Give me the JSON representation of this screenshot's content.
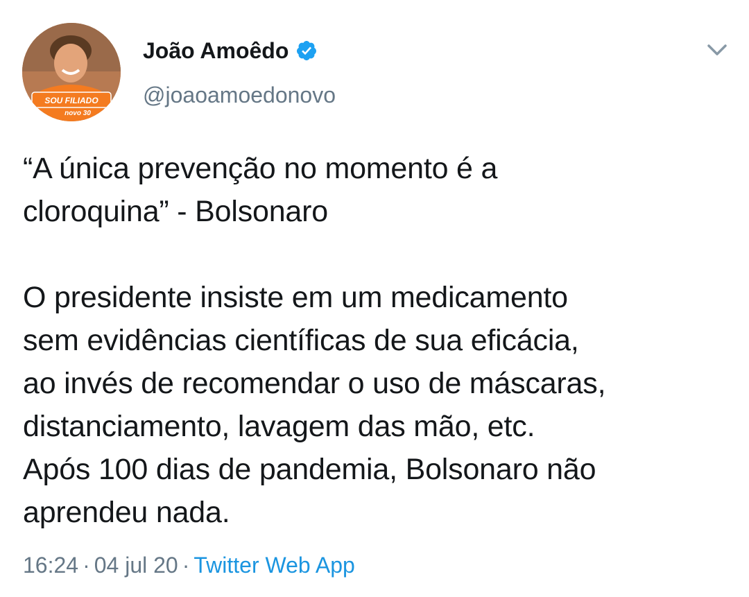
{
  "author": {
    "name": "João Amoêdo",
    "handle": "@joaoamoedonovo",
    "verified": true,
    "avatar_badge_text": "SOU FILIADO",
    "avatar_badge_sub": "novo 30"
  },
  "tweet": {
    "text": "“A única prevenção no momento é a\ncloroquina” - Bolsonaro\n\nO presidente insiste em um medicamento\nsem evidências científicas de sua eficácia,\nao invés de recomendar o uso de máscaras,\ndistanciamento, lavagem das mão, etc.\nApós 100 dias de pandemia, Bolsonaro não\naprendeu nada.",
    "time": "16:24",
    "date": "04 jul 20",
    "separator": "·",
    "source": "Twitter Web App"
  },
  "colors": {
    "text": "#14171a",
    "secondary": "#657786",
    "link": "#1b95e0",
    "verified": "#1da1f2",
    "badge": "#f47b20"
  },
  "icons": {
    "verified": "verified-badge-icon",
    "menu": "chevron-down-icon"
  }
}
